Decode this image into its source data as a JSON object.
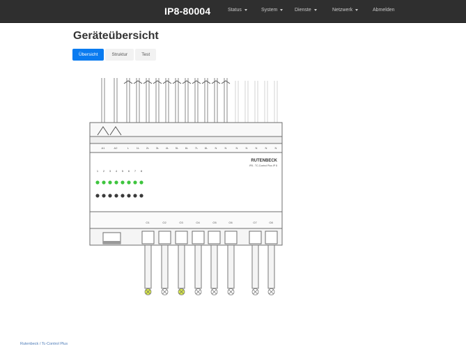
{
  "nav": {
    "brand": "IP8-80004",
    "menus": [
      {
        "label": "Status"
      },
      {
        "label": "System"
      },
      {
        "label": "Dienste"
      },
      {
        "label": "Netzwerk"
      }
    ],
    "logout": "Abmelden"
  },
  "page": {
    "title": "Geräteübersicht"
  },
  "tabs": [
    {
      "label": "Übersicht",
      "active": true
    },
    {
      "label": "Struktur",
      "active": false
    },
    {
      "label": "Test",
      "active": false
    }
  ],
  "device": {
    "brand": "RUTENBECK",
    "model": "IP8 - TC-Control Plus IP 8",
    "top_terminal_labels": [
      "A1",
      "A2",
      "L",
      "1L",
      "2L",
      "3L",
      "4L",
      "5L",
      "6L",
      "7L",
      "8L",
      "N",
      "N",
      "N",
      "N",
      "N",
      "N",
      "N"
    ],
    "led_numbers": [
      "1",
      "2",
      "3",
      "4",
      "5",
      "6",
      "7",
      "8"
    ],
    "green_led_on": [
      true,
      true,
      true,
      true,
      true,
      true,
      true,
      true
    ],
    "output_labels": [
      "O1",
      "O2",
      "O3",
      "O4",
      "O5",
      "O6",
      "O7",
      "O8"
    ],
    "output_state_on": [
      true,
      false,
      true,
      false,
      false,
      false,
      false,
      false
    ]
  },
  "footer": {
    "link": "Rutenbeck / Tc-Control Plus"
  },
  "colors": {
    "navbar": "#2f2f2f",
    "accent": "#0a7bf0",
    "led_green": "#3ec53e",
    "output_on": "#d8e84a"
  }
}
